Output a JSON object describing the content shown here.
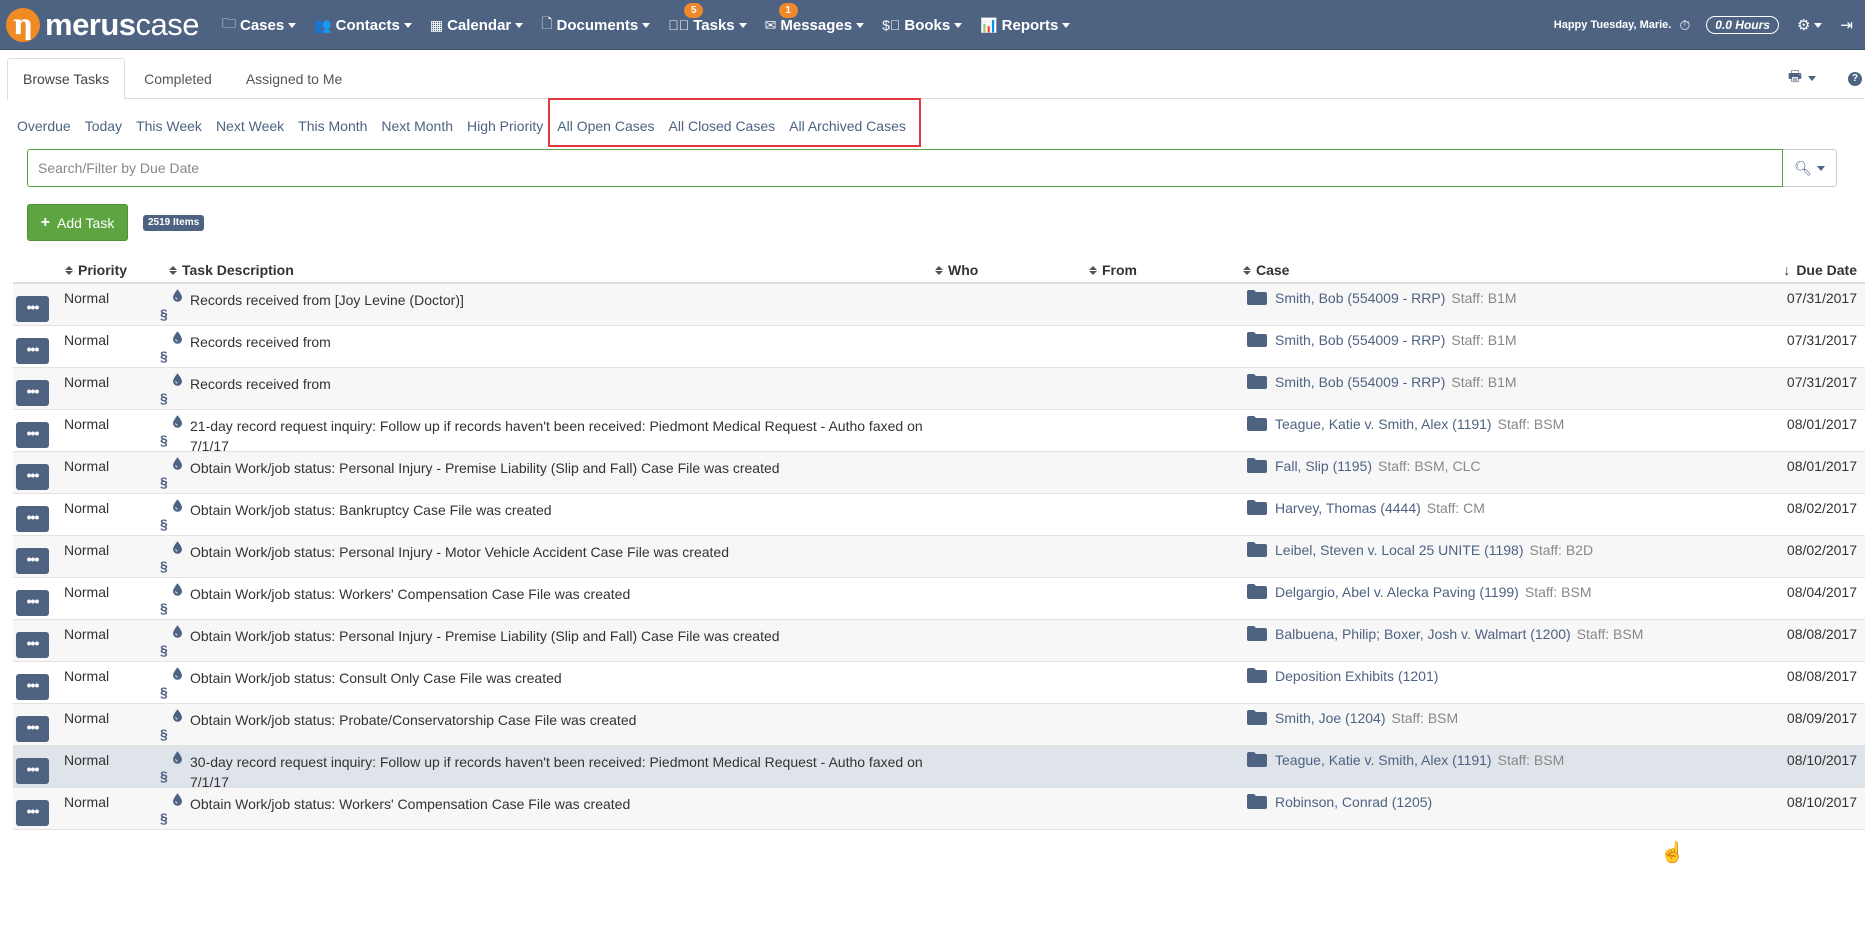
{
  "nav": {
    "logo_bold": "merus",
    "logo_light": "case",
    "items": [
      {
        "label": "Cases",
        "icon": "folder-icon"
      },
      {
        "label": "Contacts",
        "icon": "users-icon"
      },
      {
        "label": "Calendar",
        "icon": "calendar-icon"
      },
      {
        "label": "Documents",
        "icon": "document-icon"
      },
      {
        "label": "Tasks",
        "icon": "check-circle-icon",
        "badge": "5"
      },
      {
        "label": "Messages",
        "icon": "envelope-icon",
        "badge": "1"
      },
      {
        "label": "Books",
        "icon": "dollar-circle-icon"
      },
      {
        "label": "Reports",
        "icon": "bar-chart-icon"
      }
    ],
    "greeting": "Happy Tuesday, Marie.",
    "hours": "0.0 Hours"
  },
  "tabs": [
    "Browse Tasks",
    "Completed",
    "Assigned to Me"
  ],
  "filters": [
    "Overdue",
    "Today",
    "This Week",
    "Next Week",
    "This Month",
    "Next Month",
    "High Priority",
    "All Open Cases",
    "All Closed Cases",
    "All Archived Cases"
  ],
  "search": {
    "placeholder": "Search/Filter by Due Date"
  },
  "add_task_label": "Add Task",
  "items_count": "2519 Items",
  "columns": {
    "priority": "Priority",
    "description": "Task Description",
    "who": "Who",
    "from": "From",
    "case": "Case",
    "due": "Due Date"
  },
  "colors": {
    "nav": "#4e6382",
    "accent": "#f08a24",
    "add_button": "#5ea542",
    "highlight": "#e0393e"
  },
  "rows": [
    {
      "priority": "Normal",
      "description": "Records received from [Joy Levine (Doctor)]",
      "case": "Smith, Bob (554009 - RRP)",
      "staff": "Staff: B1M",
      "due": "07/31/2017"
    },
    {
      "priority": "Normal",
      "description": "Records received from",
      "case": "Smith, Bob (554009 - RRP)",
      "staff": "Staff: B1M",
      "due": "07/31/2017"
    },
    {
      "priority": "Normal",
      "description": "Records received from",
      "case": "Smith, Bob (554009 - RRP)",
      "staff": "Staff: B1M",
      "due": "07/31/2017"
    },
    {
      "priority": "Normal",
      "description": "21-day record request inquiry: Follow up if records haven't been received: Piedmont Medical Request - Autho faxed on 7/1/17",
      "case": "Teague, Katie v. Smith, Alex (1191)",
      "staff": "Staff: BSM",
      "due": "08/01/2017"
    },
    {
      "priority": "Normal",
      "description": "Obtain Work/job status: Personal Injury - Premise Liability (Slip and Fall) Case File was created",
      "case": "Fall, Slip (1195)",
      "staff": "Staff: BSM, CLC",
      "due": "08/01/2017"
    },
    {
      "priority": "Normal",
      "description": "Obtain Work/job status: Bankruptcy Case File was created",
      "case": "Harvey, Thomas (4444)",
      "staff": "Staff: CM",
      "due": "08/02/2017"
    },
    {
      "priority": "Normal",
      "description": "Obtain Work/job status: Personal Injury - Motor Vehicle Accident Case File was created",
      "case": "Leibel, Steven v. Local 25 UNITE (1198)",
      "staff": "Staff: B2D",
      "due": "08/02/2017"
    },
    {
      "priority": "Normal",
      "description": "Obtain Work/job status: Workers' Compensation Case File was created",
      "case": "Delgargio, Abel v. Alecka Paving (1199)",
      "staff": "Staff: BSM",
      "due": "08/04/2017"
    },
    {
      "priority": "Normal",
      "description": "Obtain Work/job status: Personal Injury - Premise Liability (Slip and Fall) Case File was created",
      "case": "Balbuena, Philip; Boxer, Josh v. Walmart (1200)",
      "staff": "Staff: BSM",
      "due": "08/08/2017"
    },
    {
      "priority": "Normal",
      "description": "Obtain Work/job status: Consult Only Case File was created",
      "case": "Deposition Exhibits (1201)",
      "staff": "",
      "due": "08/08/2017"
    },
    {
      "priority": "Normal",
      "description": "Obtain Work/job status: Probate/Conservatorship Case File was created",
      "case": "Smith, Joe (1204)",
      "staff": "Staff: BSM",
      "due": "08/09/2017"
    },
    {
      "priority": "Normal",
      "description": "30-day record request inquiry: Follow up if records haven't been received: Piedmont Medical Request - Autho faxed on 7/1/17",
      "case": "Teague, Katie v. Smith, Alex (1191)",
      "staff": "Staff: BSM",
      "due": "08/10/2017"
    },
    {
      "priority": "Normal",
      "description": "Obtain Work/job status: Workers' Compensation Case File was created",
      "case": "Robinson, Conrad (1205)",
      "staff": "",
      "due": "08/10/2017"
    }
  ]
}
